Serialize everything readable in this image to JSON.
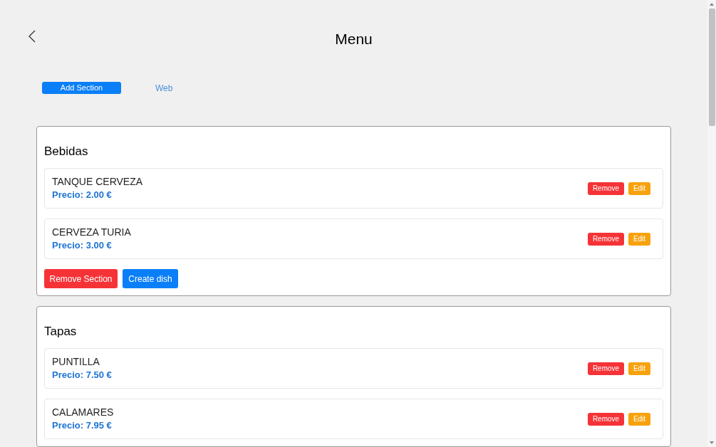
{
  "header": {
    "title": "Menu"
  },
  "actions": {
    "add_section": "Add Section",
    "web": "Web"
  },
  "sections": [
    {
      "title": "Bebidas",
      "dishes": [
        {
          "name": "TANQUE CERVEZA",
          "price": "Precio: 2.00 €",
          "remove": "Remove",
          "edit": "Edit"
        },
        {
          "name": "CERVEZA TURIA",
          "price": "Precio: 3.00 €",
          "remove": "Remove",
          "edit": "Edit"
        }
      ],
      "remove_section": "Remove Section",
      "create_dish": "Create dish"
    },
    {
      "title": "Tapas",
      "dishes": [
        {
          "name": "PUNTILLA",
          "price": "Precio: 7.50 €",
          "remove": "Remove",
          "edit": "Edit"
        },
        {
          "name": "CALAMARES",
          "price": "Precio: 7.95 €",
          "remove": "Remove",
          "edit": "Edit"
        }
      ]
    }
  ]
}
